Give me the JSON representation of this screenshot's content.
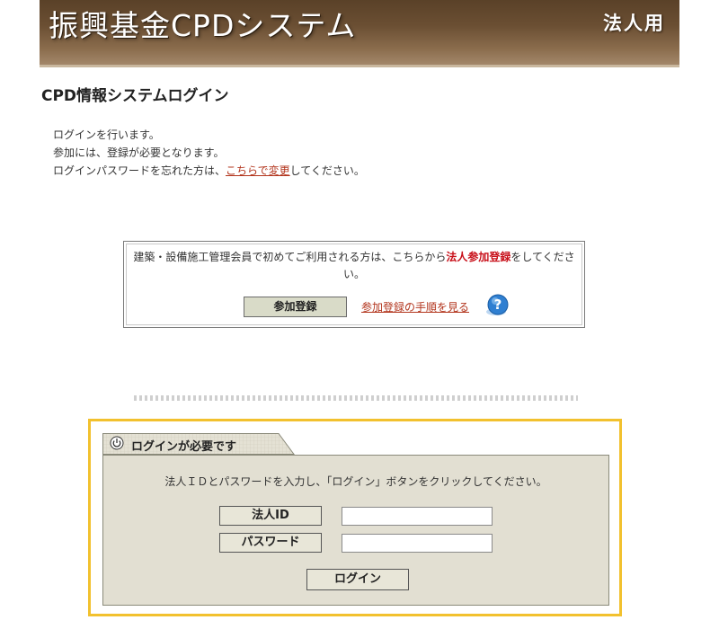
{
  "header": {
    "title": "振興基金CPDシステム",
    "badge": "法人用"
  },
  "page": {
    "title": "CPD情報システムログイン"
  },
  "intro": {
    "line1": "ログインを行います。",
    "line2": "参加には、登録が必要となります。",
    "line3_before": "ログインパスワードを忘れた方は、",
    "line3_link": "こちらで変更",
    "line3_after": "してください。"
  },
  "notice": {
    "text_before": "建築・設備施工管理会員で初めてご利用される方は、こちらから",
    "text_emphasis": "法人参加登録",
    "text_after": "をしてください。",
    "register_button": "参加登録",
    "howto_link": "参加登録の手順を見る",
    "help_icon": "question-icon"
  },
  "login": {
    "tab_label": "ログインが必要です",
    "tab_icon": "power-icon",
    "instruction": "法人ＩＤとパスワードを入力し、「ログイン」ボタンをクリックしてください。",
    "id_label": "法人ID",
    "id_value": "",
    "password_label": "パスワード",
    "password_value": "",
    "submit_label": "ログイン"
  },
  "colors": {
    "header_brown": "#6b4f33",
    "link_red": "#b2341c",
    "emphasis_red": "#c8101a",
    "highlight_yellow": "#f2c12e",
    "panel_bg": "#e2dfd2",
    "help_blue": "#2f7fd1"
  }
}
